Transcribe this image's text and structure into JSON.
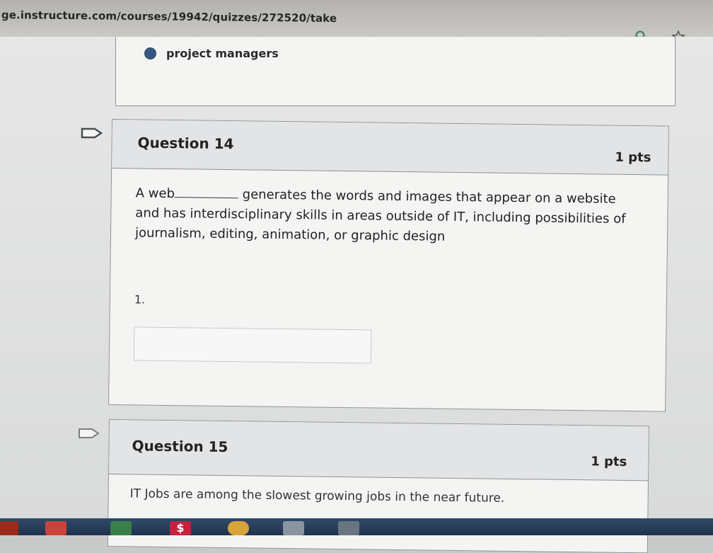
{
  "browser": {
    "url": "ge.instructure.com/courses/19942/quizzes/272520/take",
    "icons": [
      "zoom-icon",
      "star-icon"
    ]
  },
  "previous_question": {
    "answer_label": "project managers"
  },
  "question14": {
    "title": "Question 14",
    "points": "1 pts",
    "text_before_blank": "A web",
    "text_after_blank": "generates the words and images that appear on a website and has interdisciplinary skills in areas outside of IT, including possibilities of journalism, editing, animation, or graphic design",
    "blank_number": "1.",
    "answer_value": ""
  },
  "question15": {
    "title": "Question 15",
    "points": "1 pts",
    "text": "IT Jobs are among the slowest growing jobs in the near future."
  },
  "taskbar": {
    "dollar_label": "$"
  },
  "colors": {
    "radio_selected": "#355780",
    "header_bg": "#e3e4e6"
  }
}
